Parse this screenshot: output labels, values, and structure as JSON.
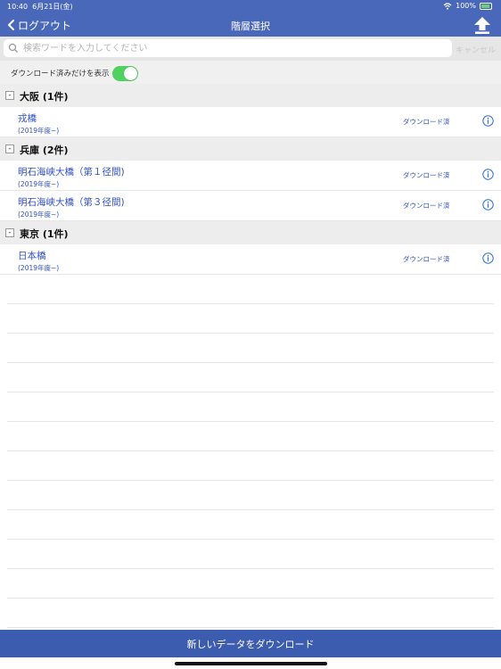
{
  "status": {
    "time": "10:40",
    "date": "6月21日(金)",
    "battery": "100%"
  },
  "nav": {
    "back_label": "ログアウト",
    "title": "階層選択"
  },
  "search": {
    "placeholder": "検索ワードを入力してください",
    "value": "",
    "cancel_label": "キャンセル"
  },
  "filter": {
    "label": "ダウンロード済みだけを表示",
    "enabled": true
  },
  "sections": [
    {
      "collapse": "-",
      "title": "大阪 (1件)",
      "items": [
        {
          "name": "戎橋",
          "sub": "(2019年度~)",
          "status": "ダウンロード済"
        }
      ]
    },
    {
      "collapse": "-",
      "title": "兵庫 (2件)",
      "items": [
        {
          "name": "明石海峡大橋（第１径間)",
          "sub": "(2019年度~)",
          "status": "ダウンロード済"
        },
        {
          "name": "明石海峡大橋（第３径間)",
          "sub": "(2019年度~)",
          "status": "ダウンロード済"
        }
      ]
    },
    {
      "collapse": "-",
      "title": "東京 (1件)",
      "items": [
        {
          "name": "日本橋",
          "sub": "(2019年度~)",
          "status": "ダウンロード済"
        }
      ]
    }
  ],
  "footer": {
    "button_label": "新しいデータをダウンロード"
  },
  "colors": {
    "nav_bg": "#4a68b9",
    "link": "#2f50c7",
    "toggle_on": "#4fd25f",
    "footer_bg": "#3c5caf"
  },
  "icons": {
    "back": "chevron-left-icon",
    "upload": "upload-icon",
    "search": "search-icon",
    "info": "info-icon",
    "wifi": "wifi-icon",
    "battery": "battery-icon"
  }
}
